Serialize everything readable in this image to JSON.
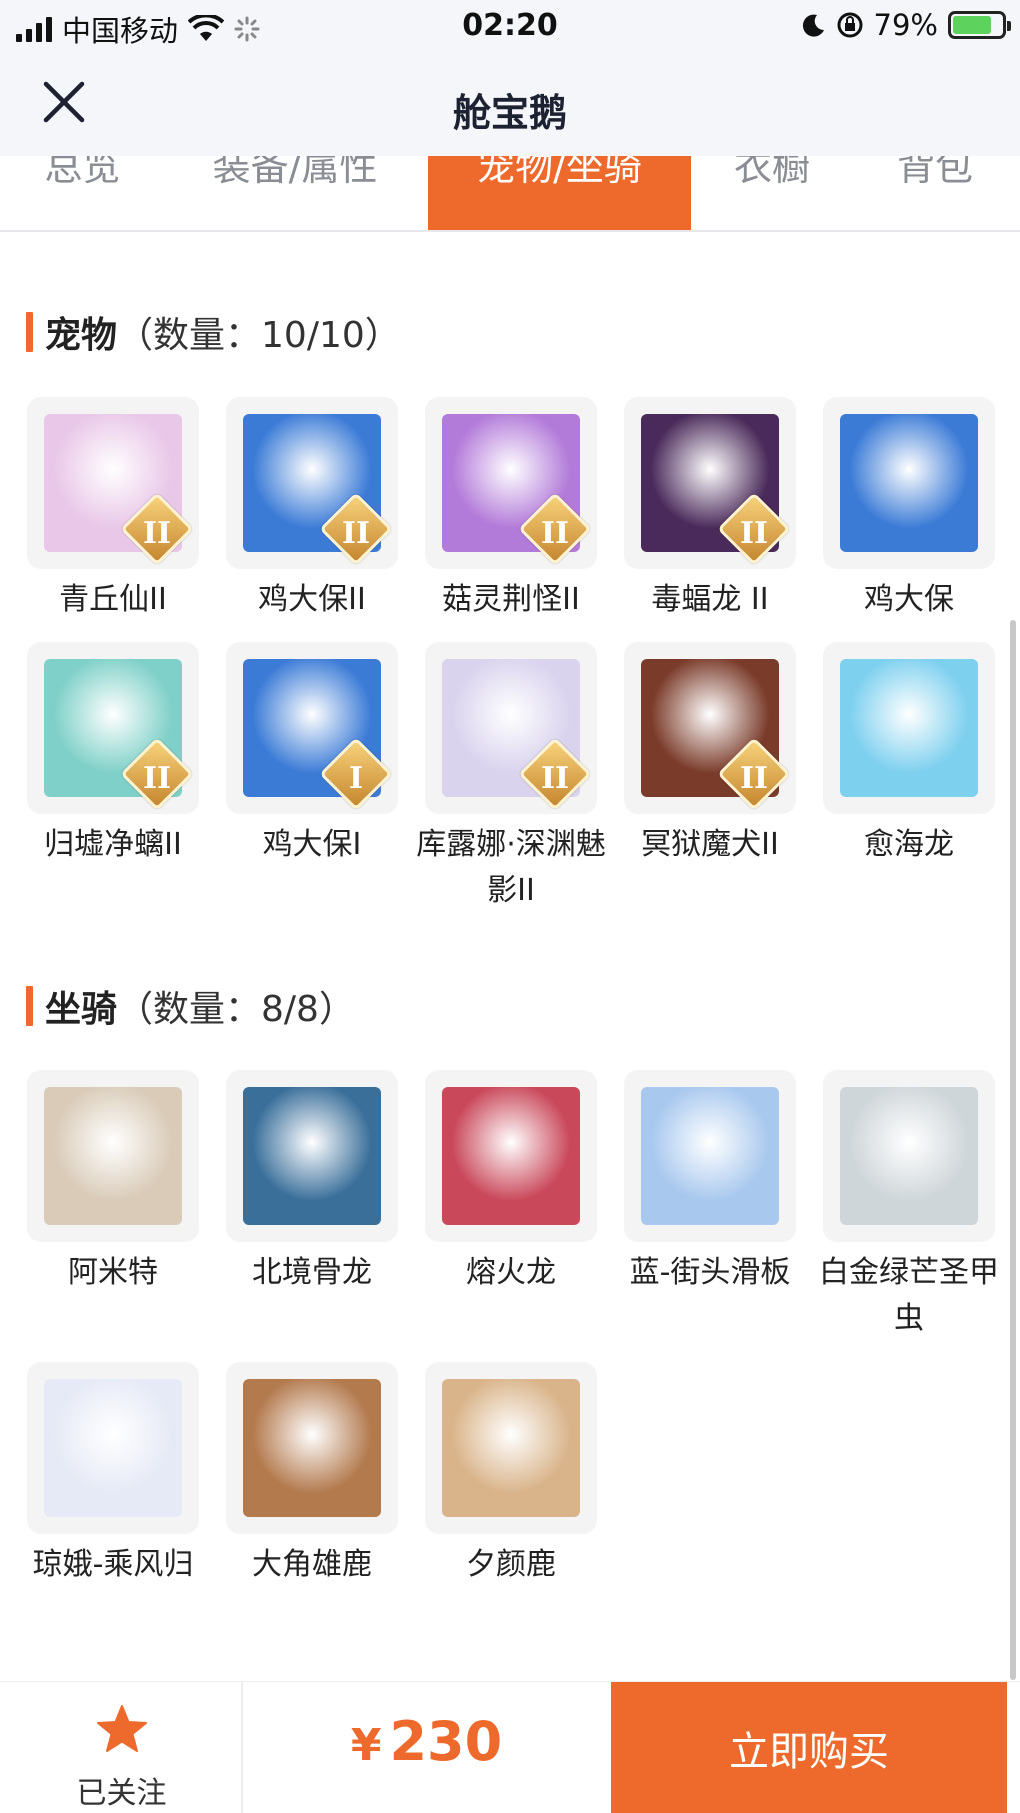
{
  "status": {
    "carrier": "中国移动",
    "time": "02:20",
    "battery": "79%",
    "battery_level": 0.79
  },
  "header": {
    "title": "舱宝鹅",
    "close_icon": "close-icon"
  },
  "tabs": [
    {
      "label": "总览",
      "active": false
    },
    {
      "label": "装备/属性",
      "active": false
    },
    {
      "label": "宠物/坐骑",
      "active": true
    },
    {
      "label": "衣橱",
      "active": false
    },
    {
      "label": "背包",
      "active": false
    }
  ],
  "pets": {
    "name": "宠物",
    "count": "（数量：10/10）",
    "items": [
      {
        "label": "青丘仙II",
        "badge": "II",
        "color": "#e9c7e8"
      },
      {
        "label": "鸡大保II",
        "badge": "II",
        "color": "#3b7bd6"
      },
      {
        "label": "菇灵荆怪II",
        "badge": "II",
        "color": "#b27ad9"
      },
      {
        "label": "毒蝠龙 II",
        "badge": "II",
        "color": "#4a2a5a"
      },
      {
        "label": "鸡大保",
        "badge": "",
        "color": "#3b7bd6"
      },
      {
        "label": "归墟净螭II",
        "badge": "II",
        "color": "#7fd0c8"
      },
      {
        "label": "鸡大保I",
        "badge": "I",
        "color": "#3b7bd6"
      },
      {
        "label": "库露娜·深渊魅影II",
        "badge": "II",
        "color": "#d9d3ee"
      },
      {
        "label": "冥狱魔犬II",
        "badge": "II",
        "color": "#7a3b2a"
      },
      {
        "label": "愈海龙",
        "badge": "",
        "color": "#7ed0ef"
      }
    ]
  },
  "mounts": {
    "name": "坐骑",
    "count": "（数量：8/8）",
    "items": [
      {
        "label": "阿米特",
        "color": "#d9cbb8"
      },
      {
        "label": "北境骨龙",
        "color": "#3a6f9a"
      },
      {
        "label": "熔火龙",
        "color": "#c9485a"
      },
      {
        "label": "蓝-街头滑板",
        "color": "#a8c8ee"
      },
      {
        "label": "白金绿芒圣甲虫",
        "color": "#cfd6d9"
      },
      {
        "label": "琼娥-乘风归",
        "color": "#e6eaf6"
      },
      {
        "label": "大角雄鹿",
        "color": "#b37a4e"
      },
      {
        "label": "夕颜鹿",
        "color": "#d9b48a"
      }
    ]
  },
  "bottom": {
    "follow_label": "已关注",
    "price_symbol": "¥",
    "price": "230",
    "buy_label": "立即购买"
  },
  "colors": {
    "accent": "#ee6a2c"
  }
}
